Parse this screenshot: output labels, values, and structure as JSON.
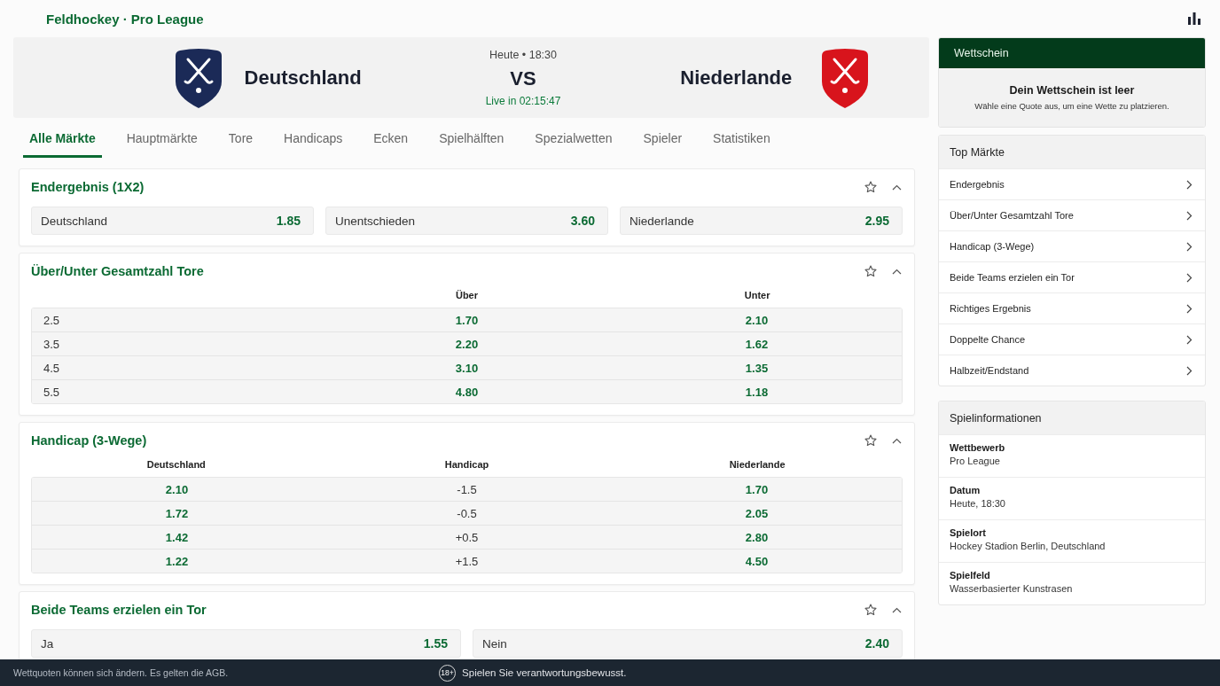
{
  "breadcrumb": "Feldhockey · Pro League",
  "teams": [
    {
      "name": "Deutschland",
      "color": "#1b2a57"
    },
    {
      "name": "Niederlande",
      "color": "#d8141c"
    }
  ],
  "match": {
    "date": "Heute • 18:30",
    "vs": "VS",
    "countdown": "Live in 02:15:47"
  },
  "tabs": [
    {
      "label": "Alle Märkte",
      "selected": true
    },
    {
      "label": "Hauptmärkte",
      "selected": false
    },
    {
      "label": "Tore",
      "selected": false
    },
    {
      "label": "Handicaps",
      "selected": false
    },
    {
      "label": "Ecken",
      "selected": false
    },
    {
      "label": "Spielhälften",
      "selected": false
    },
    {
      "label": "Spezialwetten",
      "selected": false
    },
    {
      "label": "Spieler",
      "selected": false
    },
    {
      "label": "Statistiken",
      "selected": false
    }
  ],
  "markets": [
    {
      "kind": "outcomes",
      "title": "Endergebnis (1X2)",
      "favorite": false,
      "expanded": true,
      "outcomes": [
        {
          "label": "Deutschland",
          "odds": "1.85"
        },
        {
          "label": "Unentschieden",
          "odds": "3.60"
        },
        {
          "label": "Niederlande",
          "odds": "2.95"
        }
      ]
    },
    {
      "kind": "lines",
      "title": "Über/Unter Gesamtzahl Tore",
      "favorite": false,
      "expanded": true,
      "columns": [
        "Über",
        "Unter"
      ],
      "rows": [
        {
          "line": "2.5",
          "odds": [
            "1.70",
            "2.10"
          ]
        },
        {
          "line": "3.5",
          "odds": [
            "2.20",
            "1.62"
          ]
        },
        {
          "line": "4.5",
          "odds": [
            "3.10",
            "1.35"
          ]
        },
        {
          "line": "5.5",
          "odds": [
            "4.80",
            "1.18"
          ]
        }
      ]
    },
    {
      "kind": "handicap",
      "title": "Handicap (3-Wege)",
      "favorite": false,
      "expanded": true,
      "columns": [
        "Deutschland",
        "Handicap",
        "Niederlande"
      ],
      "rows": [
        {
          "home": "2.10",
          "line": "-1.5",
          "away": "1.70"
        },
        {
          "home": "1.72",
          "line": "-0.5",
          "away": "2.05"
        },
        {
          "home": "1.42",
          "line": "+0.5",
          "away": "2.80"
        },
        {
          "home": "1.22",
          "line": "+1.5",
          "away": "4.50"
        }
      ]
    },
    {
      "kind": "outcomes",
      "title": "Beide Teams erzielen ein Tor",
      "favorite": false,
      "expanded": true,
      "outcomes": [
        {
          "label": "Ja",
          "odds": "1.55"
        },
        {
          "label": "Nein",
          "odds": "2.40"
        }
      ]
    }
  ],
  "betslip": {
    "title": "Wettschein",
    "empty_title": "Dein Wettschein ist leer",
    "empty_hint": "Wähle eine Quote aus, um eine Wette zu platzieren."
  },
  "top_markets": {
    "title": "Top Märkte",
    "items": [
      "Endergebnis",
      "Über/Unter Gesamtzahl Tore",
      "Handicap (3-Wege)",
      "Beide Teams erzielen ein Tor",
      "Richtiges Ergebnis",
      "Doppelte Chance",
      "Halbzeit/Endstand"
    ]
  },
  "match_info": {
    "title": "Spielinformationen",
    "items": [
      {
        "label": "Wettbewerb",
        "value": "Pro League"
      },
      {
        "label": "Datum",
        "value": "Heute, 18:30"
      },
      {
        "label": "Spielort",
        "value": "Hockey Stadion Berlin, Deutschland"
      },
      {
        "label": "Spielfeld",
        "value": "Wasserbasierter Kunstrasen"
      }
    ]
  },
  "footer": {
    "disclaimer": "Wettquoten können sich ändern. Es gelten die AGB.",
    "age_limit": "18+",
    "message": "Spielen Sie verantwortungsbewusst."
  }
}
